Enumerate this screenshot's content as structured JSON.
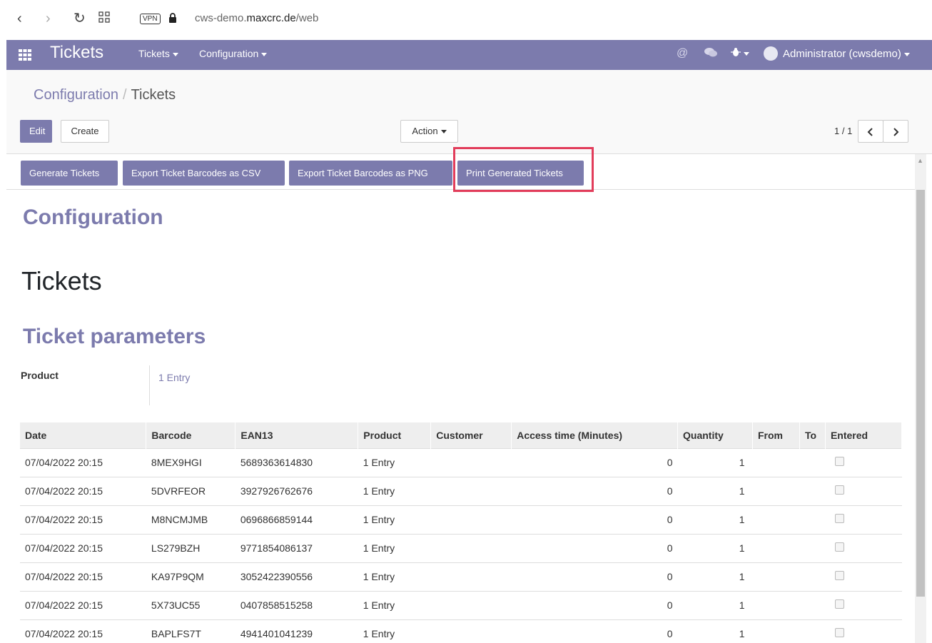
{
  "browser": {
    "vpn": "VPN",
    "url_prefix": "cws-demo.",
    "url_domain": "maxcrc.de",
    "url_path": "/web"
  },
  "topnav": {
    "app_title": "Tickets",
    "menu_tickets": "Tickets",
    "menu_configuration": "Configuration",
    "user": "Administrator (cwsdemo)"
  },
  "breadcrumb": {
    "parent": "Configuration",
    "separator": "/",
    "current": "Tickets"
  },
  "toolbar": {
    "edit": "Edit",
    "create": "Create",
    "action": "Action",
    "pager": "1 / 1"
  },
  "header_buttons": {
    "generate": "Generate Tickets",
    "export_csv": "Export Ticket Barcodes as CSV",
    "export_png": "Export Ticket Barcodes as PNG",
    "print": "Print Generated Tickets"
  },
  "sheet": {
    "title": "Configuration",
    "name": "Tickets",
    "section": "Ticket parameters",
    "product_label": "Product",
    "product_value": "1 Entry"
  },
  "table": {
    "columns": [
      "Date",
      "Barcode",
      "EAN13",
      "Product",
      "Customer",
      "Access time (Minutes)",
      "Quantity",
      "From",
      "To",
      "Entered"
    ],
    "rows": [
      {
        "date": "07/04/2022 20:15",
        "barcode": "8MEX9HGI",
        "ean13": "5689363614830",
        "product": "1 Entry",
        "customer": "",
        "access": "0",
        "qty": "1",
        "from": "",
        "to": ""
      },
      {
        "date": "07/04/2022 20:15",
        "barcode": "5DVRFEOR",
        "ean13": "3927926762676",
        "product": "1 Entry",
        "customer": "",
        "access": "0",
        "qty": "1",
        "from": "",
        "to": ""
      },
      {
        "date": "07/04/2022 20:15",
        "barcode": "M8NCMJMB",
        "ean13": "0696866859144",
        "product": "1 Entry",
        "customer": "",
        "access": "0",
        "qty": "1",
        "from": "",
        "to": ""
      },
      {
        "date": "07/04/2022 20:15",
        "barcode": "LS279BZH",
        "ean13": "9771854086137",
        "product": "1 Entry",
        "customer": "",
        "access": "0",
        "qty": "1",
        "from": "",
        "to": ""
      },
      {
        "date": "07/04/2022 20:15",
        "barcode": "KA97P9QM",
        "ean13": "3052422390556",
        "product": "1 Entry",
        "customer": "",
        "access": "0",
        "qty": "1",
        "from": "",
        "to": ""
      },
      {
        "date": "07/04/2022 20:15",
        "barcode": "5X73UC55",
        "ean13": "0407858515258",
        "product": "1 Entry",
        "customer": "",
        "access": "0",
        "qty": "1",
        "from": "",
        "to": ""
      },
      {
        "date": "07/04/2022 20:15",
        "barcode": "BAPLFS7T",
        "ean13": "4941401041239",
        "product": "1 Entry",
        "customer": "",
        "access": "0",
        "qty": "1",
        "from": "",
        "to": ""
      }
    ]
  },
  "colors": {
    "brand": "#7c7bad",
    "highlight": "#e23d5b"
  }
}
